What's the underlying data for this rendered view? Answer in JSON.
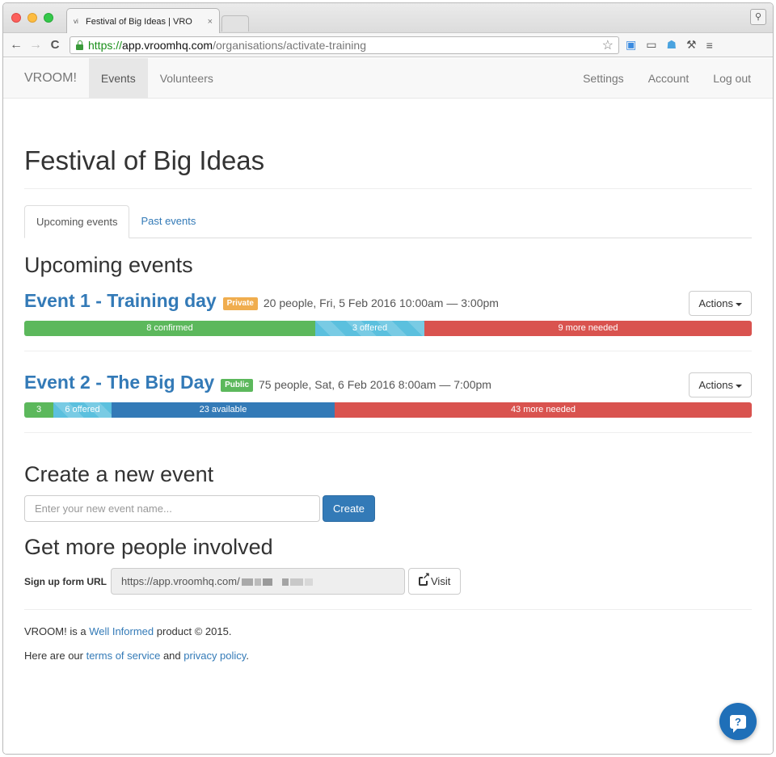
{
  "browser": {
    "tab_title": "Festival of Big Ideas | VRO",
    "tab_favicon": "vi",
    "tab_close": "×",
    "url_scheme": "https://",
    "url_host": "app.vroomhq.com",
    "url_path": "/organisations/activate-training",
    "profile_glyph": "⚲"
  },
  "navbar": {
    "brand": "VROOM!",
    "left": [
      "Events",
      "Volunteers"
    ],
    "right": [
      "Settings",
      "Account",
      "Log out"
    ]
  },
  "page": {
    "title": "Festival of Big Ideas",
    "tabs": [
      "Upcoming events",
      "Past events"
    ],
    "section_title": "Upcoming events"
  },
  "events": [
    {
      "title": "Event 1 - Training day",
      "visibility": "Private",
      "details": "20 people, Fri, 5 Feb 2016 10:00am — 3:00pm",
      "actions_label": "Actions",
      "progress": [
        {
          "kind": "confirmed",
          "label": "8 confirmed",
          "value": 8
        },
        {
          "kind": "offered",
          "label": "3 offered",
          "value": 3
        },
        {
          "kind": "needed",
          "label": "9 more needed",
          "value": 9
        }
      ]
    },
    {
      "title": "Event 2 - The Big Day",
      "visibility": "Public",
      "details": "75 people, Sat, 6 Feb 2016 8:00am — 7:00pm",
      "actions_label": "Actions",
      "progress": [
        {
          "kind": "confirmed",
          "label": "3",
          "value": 3
        },
        {
          "kind": "offered",
          "label": "6 offered",
          "value": 6
        },
        {
          "kind": "available",
          "label": "23 available",
          "value": 23
        },
        {
          "kind": "needed",
          "label": "43 more needed",
          "value": 43
        }
      ]
    }
  ],
  "create": {
    "heading": "Create a new event",
    "placeholder": "Enter your new event name...",
    "button": "Create"
  },
  "involve": {
    "heading": "Get more people involved",
    "label": "Sign up form URL",
    "url_value": "https://app.vroomhq.com/",
    "visit_button": "Visit"
  },
  "footer": {
    "line1_pre": "VROOM! is a ",
    "line1_link": "Well Informed",
    "line1_post": " product © 2015.",
    "line2_pre": "Here are our ",
    "line2_link1": "terms of service",
    "line2_mid": " and ",
    "line2_link2": "privacy policy",
    "line2_post": "."
  },
  "help": {
    "glyph": "?"
  }
}
